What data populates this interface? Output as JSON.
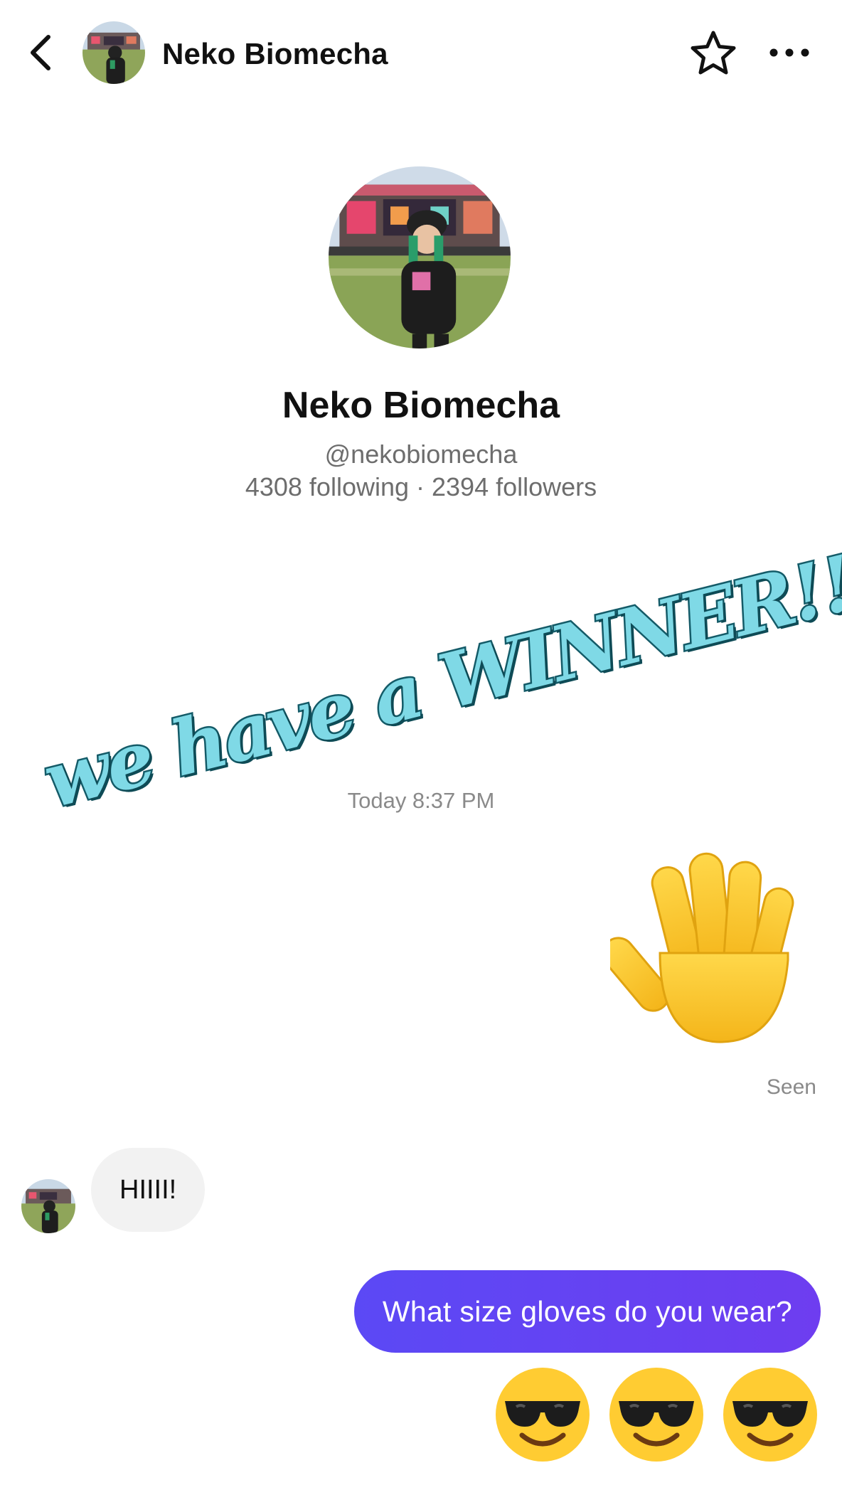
{
  "header": {
    "back_icon": "chevron-left-icon",
    "name": "Neko Biomecha",
    "favorite_icon": "star-outline-icon",
    "more_icon": "ellipsis-icon"
  },
  "profile": {
    "name": "Neko Biomecha",
    "handle": "@nekobiomecha",
    "stats": "4308 following · 2394 followers"
  },
  "overlay": {
    "text": "we have a WINNER!!!",
    "fill_color": "#7fd9e6",
    "stroke_color": "#145b68"
  },
  "conversation": {
    "timestamp": "Today 8:37 PM",
    "messages": [
      {
        "direction": "outgoing",
        "type": "emoji",
        "emoji": "waving-hand"
      },
      {
        "direction": "outgoing",
        "type": "status",
        "text": "Seen"
      },
      {
        "direction": "incoming",
        "type": "text",
        "text": "HIIII!"
      },
      {
        "direction": "outgoing",
        "type": "text",
        "text": "What size gloves do you wear?"
      },
      {
        "direction": "outgoing",
        "type": "emoji",
        "emoji": [
          "smiling-face-with-sunglasses",
          "smiling-face-with-sunglasses",
          "smiling-face-with-sunglasses"
        ]
      }
    ]
  },
  "colors": {
    "accent_bubble": "#5b49f5",
    "incoming_bubble": "#f2f2f2",
    "muted_text": "#6d6d6d"
  }
}
